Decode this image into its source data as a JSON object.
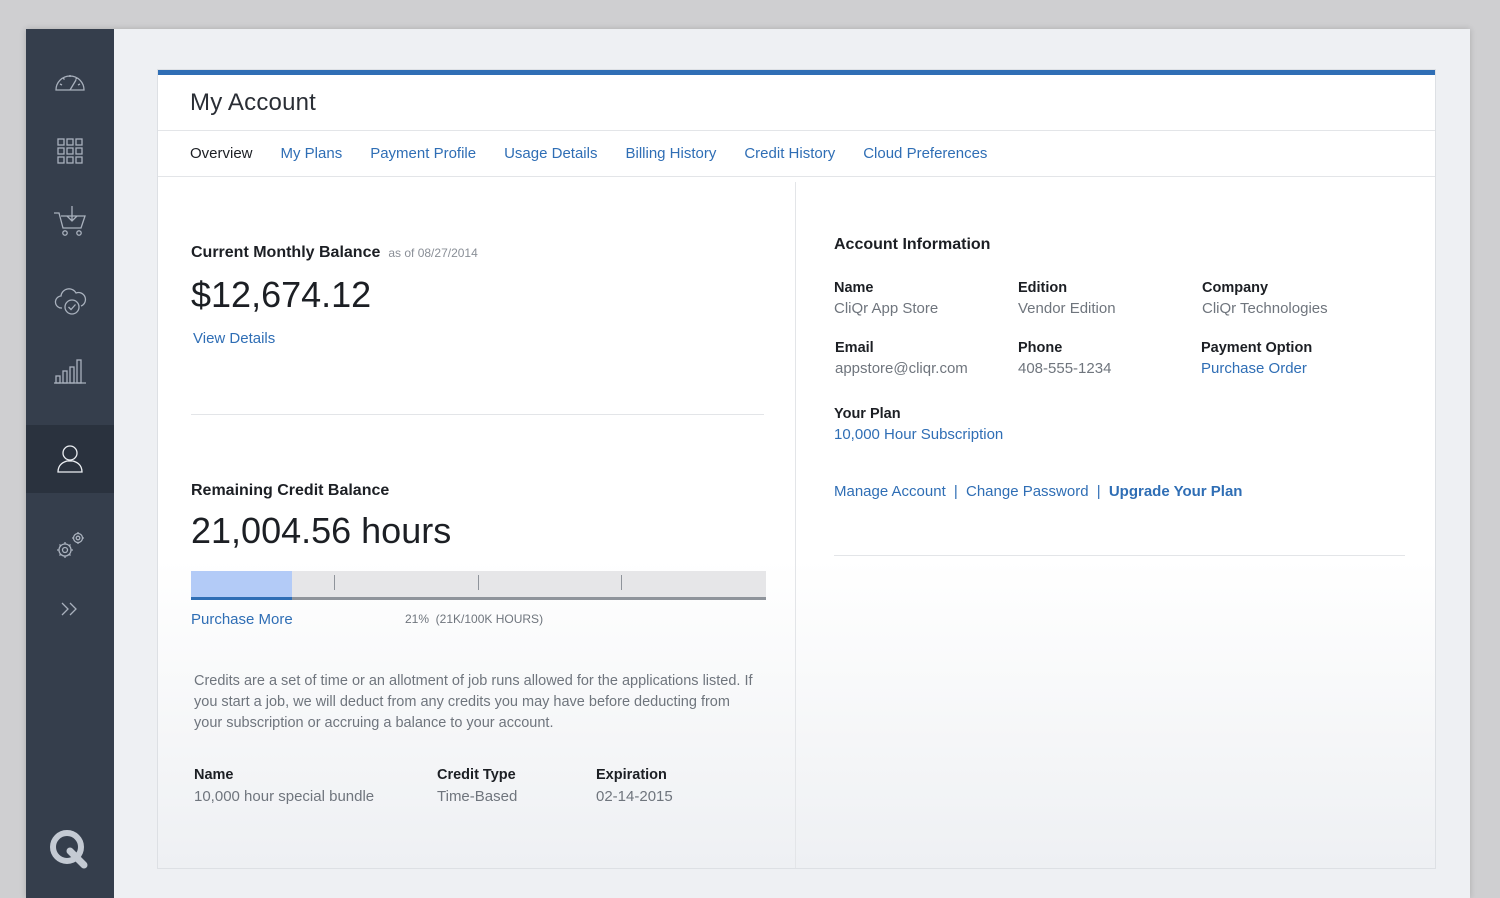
{
  "sidebar": {
    "items": [
      {
        "name": "dashboard",
        "icon": "speedometer-icon"
      },
      {
        "name": "apps",
        "icon": "grid-icon"
      },
      {
        "name": "marketplace",
        "icon": "cart-icon"
      },
      {
        "name": "clouds",
        "icon": "cloud-check-icon"
      },
      {
        "name": "reports",
        "icon": "bar-chart-icon"
      },
      {
        "name": "account",
        "icon": "user-icon",
        "active": true
      },
      {
        "name": "settings",
        "icon": "gears-icon"
      },
      {
        "name": "expand",
        "icon": "double-chevron-right-icon"
      }
    ],
    "logo": "Q"
  },
  "header": {
    "title": "My Account"
  },
  "tabs": [
    {
      "label": "Overview",
      "active": true
    },
    {
      "label": "My Plans"
    },
    {
      "label": "Payment Profile"
    },
    {
      "label": "Usage Details"
    },
    {
      "label": "Billing History"
    },
    {
      "label": "Credit History"
    },
    {
      "label": "Cloud Preferences"
    }
  ],
  "balance": {
    "title": "Current Monthly Balance",
    "as_of": "as of 08/27/2014",
    "amount": "$12,674.12",
    "view_details": "View Details"
  },
  "credit": {
    "title": "Remaining Credit Balance",
    "hours": "21,004.56 hours",
    "progress_fraction": 0.21,
    "purchase_more": "Purchase More",
    "progress_label": "21%  (21K/100K HOURS)",
    "description": "Credits are a set of time or an allotment of job runs allowed for the applications listed. If you start a job, we will deduct from any credits you may have before deducting from your subscription or accruing a balance to your account.",
    "table": {
      "headers": [
        "Name",
        "Credit Type",
        "Expiration"
      ],
      "rows": [
        [
          "10,000 hour special bundle",
          "Time-Based",
          "02-14-2015"
        ]
      ]
    }
  },
  "account_info": {
    "title": "Account Information",
    "name_label": "Name",
    "name_value": "CliQr App Store",
    "edition_label": "Edition",
    "edition_value": "Vendor Edition",
    "company_label": "Company",
    "company_value": "CliQr Technologies",
    "email_label": "Email",
    "email_value": "appstore@cliqr.com",
    "phone_label": "Phone",
    "phone_value": "408-555-1234",
    "payment_label": "Payment Option",
    "payment_value": "Purchase Order",
    "plan_label": "Your Plan",
    "plan_value": "10,000 Hour Subscription",
    "manage_account": "Manage Account",
    "change_password": "Change Password",
    "upgrade_plan": "Upgrade Your Plan",
    "separator": "|"
  },
  "colors": {
    "accent": "#2f6eb5",
    "sidebar": "#353e4c",
    "progress_fill": "#b3cbf7"
  }
}
